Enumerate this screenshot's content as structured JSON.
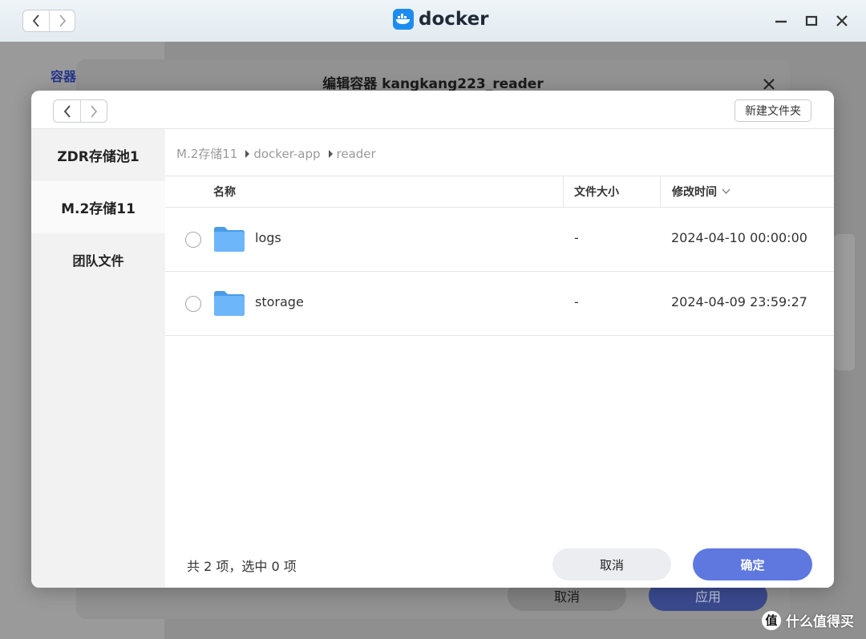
{
  "app": {
    "title": "docker",
    "sidebar_label": "容器"
  },
  "edit_dialog": {
    "title": "编辑容器 kangkang223_reader",
    "cancel_label": "取消",
    "apply_label": "应用"
  },
  "picker": {
    "new_folder_label": "新建文件夹",
    "sidebar": {
      "items": [
        {
          "label": "ZDR存储池1",
          "active": false
        },
        {
          "label": "M.2存储11",
          "active": true
        },
        {
          "label": "团队文件",
          "active": false
        }
      ]
    },
    "breadcrumb": [
      "M.2存储11",
      "docker-app",
      "reader"
    ],
    "columns": {
      "name": "名称",
      "size": "文件大小",
      "modified": "修改时间"
    },
    "rows": [
      {
        "name": "logs",
        "size": "-",
        "modified": "2024-04-10 00:00:00"
      },
      {
        "name": "storage",
        "size": "-",
        "modified": "2024-04-09 23:59:27"
      }
    ],
    "footer": {
      "count_text": "共 2 项，选中 0 项",
      "cancel_label": "取消",
      "ok_label": "确定"
    }
  },
  "watermark": {
    "badge": "值",
    "text": "什么值得买"
  },
  "colors": {
    "accent": "#5f78e0",
    "folder": "#5aa9f5",
    "docker_blue": "#1d8cf0"
  }
}
